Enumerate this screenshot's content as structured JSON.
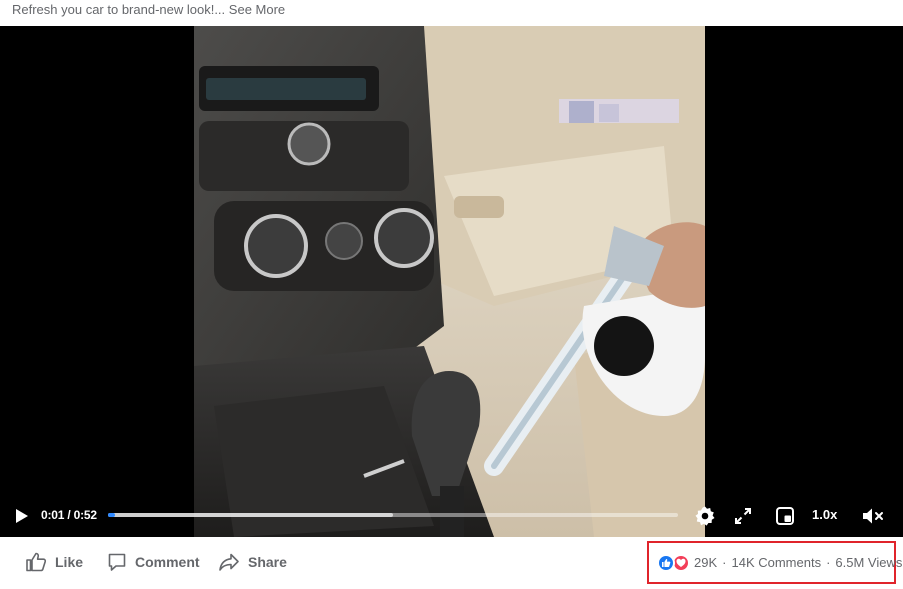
{
  "post": {
    "caption_text": "Refresh you car to brand-new look!...",
    "see_more_label": "See More"
  },
  "player": {
    "current_time": "0:01",
    "separator": " / ",
    "duration": "0:52",
    "progress_fraction": 0.012,
    "buffered_fraction": 0.5,
    "speed_label": "1.0x",
    "icons": [
      "play-icon",
      "settings-gear-icon",
      "fullscreen-icon",
      "picture-in-picture-icon",
      "mute-icon"
    ],
    "colors": {
      "progress": "#2d88ff",
      "background": "#000000"
    }
  },
  "actions": {
    "like_label": "Like",
    "comment_label": "Comment",
    "share_label": "Share"
  },
  "stats": {
    "reactions_count": "29K",
    "comments_label": "14K Comments",
    "views_label": "6.5M Views",
    "dot": "·",
    "reaction_icons": [
      "like-reaction-icon",
      "love-reaction-icon"
    ],
    "highlight_color": "#e0242b"
  }
}
